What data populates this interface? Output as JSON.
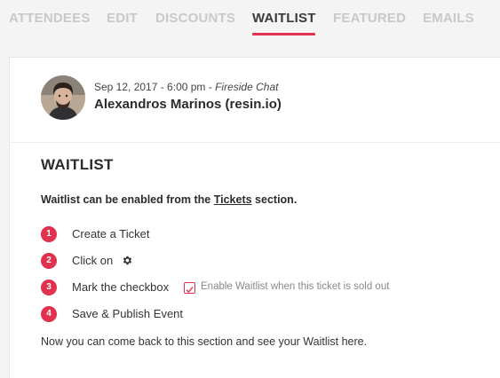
{
  "tabs": [
    {
      "label": "ATTENDEES",
      "active": false
    },
    {
      "label": "EDIT",
      "active": false
    },
    {
      "label": "DISCOUNTS",
      "active": false
    },
    {
      "label": "WAITLIST",
      "active": true
    },
    {
      "label": "FEATURED",
      "active": false
    },
    {
      "label": "EMAILS",
      "active": false
    }
  ],
  "event": {
    "date": "Sep 12, 2017 - 6:00 pm",
    "separator": " - ",
    "type": "Fireside Chat",
    "name": "Alexandros Marinos (resin.io)"
  },
  "waitlist": {
    "title": "WAITLIST",
    "intro_before": "Waitlist can be enabled from the ",
    "intro_link": "Tickets",
    "intro_after": " section.",
    "steps": [
      {
        "num": "1",
        "text": "Create a Ticket"
      },
      {
        "num": "2",
        "text": "Click on"
      },
      {
        "num": "3",
        "text": "Mark the checkbox",
        "checkbox_label": "Enable Waitlist when this ticket is sold out"
      },
      {
        "num": "4",
        "text": "Save & Publish Event"
      }
    ],
    "outro": "Now you can come back to this section and see your Waitlist here."
  },
  "colors": {
    "accent": "#e0314f",
    "tab_inactive": "#c9c9c9",
    "tab_active": "#3a3a3a"
  },
  "icons": {
    "gear": "gear-icon",
    "check": "check-icon"
  }
}
